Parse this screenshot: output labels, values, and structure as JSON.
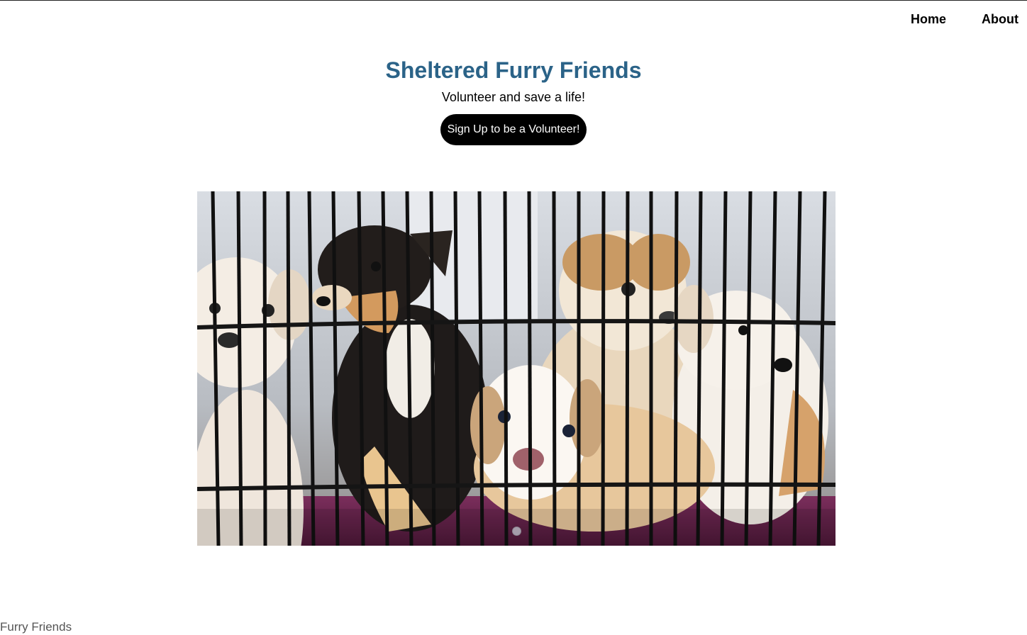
{
  "nav": {
    "items": [
      {
        "label": "Home"
      },
      {
        "label": "About"
      }
    ]
  },
  "hero": {
    "title": "Sheltered Furry Friends",
    "subtitle": "Volunteer and save a life!",
    "cta_label": "Sign Up to be a Volunteer!"
  },
  "carousel": {
    "slide_count": 1,
    "active_slide": 1
  },
  "footer": {
    "text": "Furry Friends"
  },
  "colors": {
    "title": "#2b6388",
    "button_bg": "#000000",
    "button_text": "#ffffff"
  }
}
